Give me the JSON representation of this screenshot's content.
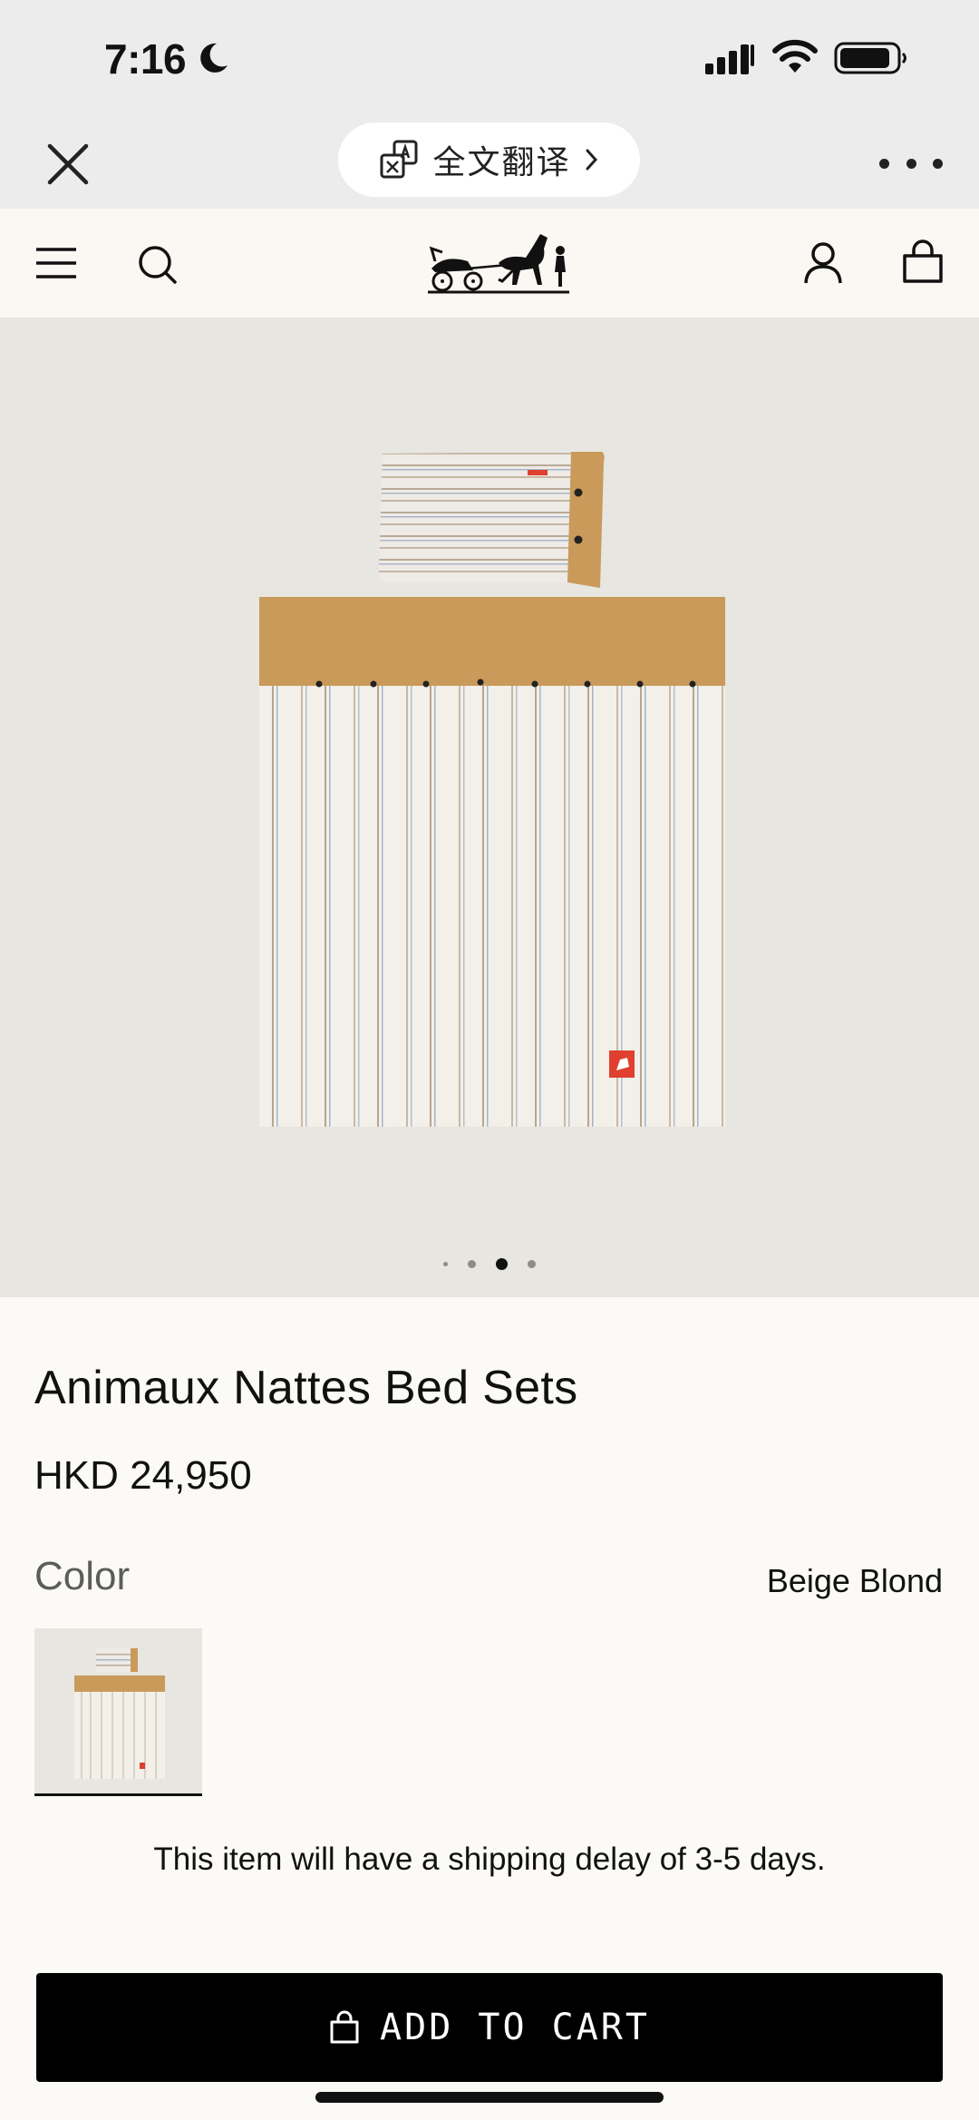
{
  "status_bar": {
    "time": "7:16"
  },
  "browser_bar": {
    "translate_label": "全文翻译"
  },
  "hero": {
    "slide_count": 4,
    "active_slide": 3
  },
  "product": {
    "title": "Animaux Nattes Bed Sets",
    "price": "HKD 24,950",
    "color_label": "Color",
    "color_value": "Beige Blond",
    "shipping_notice": "This item will have a shipping delay of 3-5 days."
  },
  "cart": {
    "label": "ADD TO CART"
  },
  "colors": {
    "accent_tan": "#c99a5a",
    "button_black": "#000000",
    "badge_red": "#e0402f"
  }
}
